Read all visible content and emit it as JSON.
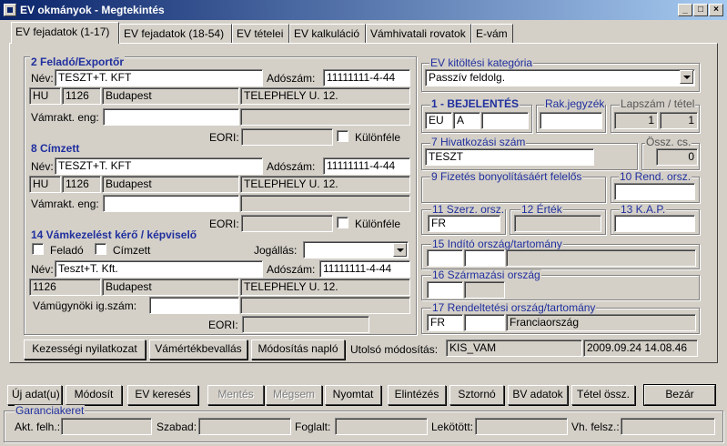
{
  "window": {
    "title": "EV okmányok - Megtekintés",
    "min": "_",
    "max": "□",
    "close": "×"
  },
  "tabs": [
    "EV fejadatok (1-17)",
    "EV fejadatok (18-54)",
    "EV tételei",
    "EV kalkuláció",
    "Vámhivatali rovatok",
    "E-vám"
  ],
  "sender": {
    "title": "2 Feladó/Exportőr",
    "name_label": "Név:",
    "name": "TESZT+T. KFT",
    "tax_label": "Adószám:",
    "tax": "11111111-4-44",
    "country": "HU",
    "zip": "1126",
    "city": "Budapest",
    "street": "TELEPHELY U. 12.",
    "warehouse_label": "Vámrakt. eng:",
    "eori_label": "EORI:",
    "various_label": "Különféle"
  },
  "consignee": {
    "title": "8 Címzett",
    "name_label": "Név:",
    "name": "TESZT+T. KFT",
    "tax_label": "Adószám:",
    "tax": "11111111-4-44",
    "country": "HU",
    "zip": "1126",
    "city": "Budapest",
    "street": "TELEPHELY U. 12.",
    "warehouse_label": "Vámrakt. eng:",
    "eori_label": "EORI:",
    "various_label": "Különféle"
  },
  "declarant": {
    "title": "14 Vámkezelést kérő / képviselő",
    "sender_label": "Feladó",
    "consignee_label": "Címzett",
    "status_label": "Jogállás:",
    "name_label": "Név:",
    "name": "Teszt+T. Kft.",
    "tax_label": "Adószám:",
    "tax": "11111111-4-44",
    "zip": "1126",
    "city": "Budapest",
    "street": "TELEPHELY U. 12.",
    "agent_label": "Vámügynöki ig.szám:",
    "eori_label": "EORI:"
  },
  "right": {
    "category_title": "EV kitöltési kategória",
    "category": "Passzív feldolg.",
    "decl_title": "1 - BEJELENTÉS",
    "decl_a": "EU",
    "decl_b": "A",
    "rak_title": "Rak.jegyzék",
    "lap_title": "Lapszám / tétel",
    "lap_a": "1",
    "lap_b": "1",
    "ref_title": "7 Hivatkozási szám",
    "ref": "TESZT",
    "total_title": "Össz. cs.",
    "total": "0",
    "payer_title": "9 Fizetés bonyolításáért felelős",
    "rend_title": "10 Rend. orsz.",
    "trade_title": "11 Szerz. orsz.",
    "trade": "FR",
    "value_title": "12 Érték",
    "kap_title": "13 K.A.P.",
    "dispatch_title": "15 Indító ország/tartomány",
    "origin_title": "16 Származási ország",
    "dest_title": "17 Rendeltetési ország/tartomány",
    "dest_code": "FR",
    "dest_name": "Franciaország"
  },
  "bottom": {
    "guarantee_btn": "Kezességi nyilatkozat",
    "value_btn": "Vámértékbevallás",
    "log_btn": "Módosítás napló",
    "last_mod_label": "Utolsó módosítás:",
    "last_mod_user": "KIS_VAM",
    "last_mod_time": "2009.09.24 14.08.46"
  },
  "toolbar": {
    "new": "Új adat(u)",
    "edit": "Módosít",
    "search": "EV keresés",
    "save": "Mentés",
    "cancel": "Mégsem",
    "print": "Nyomtat",
    "settle": "Elintézés",
    "storno": "Sztornó",
    "bv": "BV adatok",
    "items_sum": "Tétel össz.",
    "close": "Bezár"
  },
  "guarantee": {
    "title": "Garanciakeret",
    "current_label": "Akt. felh.:",
    "free_label": "Szabad:",
    "used_label": "Foglalt:",
    "locked_label": "Lekötött:",
    "vh_label": "Vh. felsz.:"
  }
}
